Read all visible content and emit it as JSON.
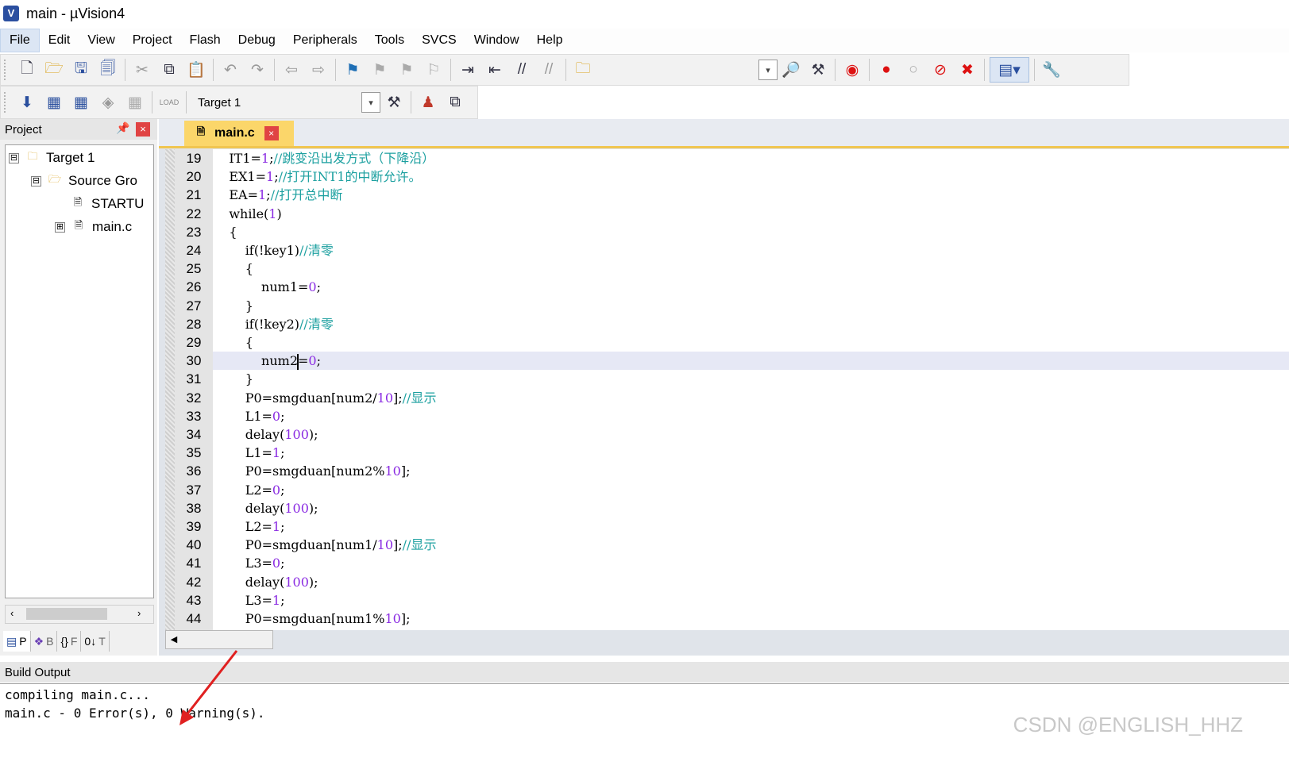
{
  "window": {
    "title": "main  - µVision4",
    "icon": "uvision-icon"
  },
  "menu": [
    "File",
    "Edit",
    "View",
    "Project",
    "Flash",
    "Debug",
    "Peripherals",
    "Tools",
    "SVCS",
    "Window",
    "Help"
  ],
  "toolbar2": {
    "target": "Target 1",
    "load_label": "LOAD"
  },
  "project_panel": {
    "title": "Project",
    "tree": [
      {
        "label": "Target 1",
        "level": 0,
        "expander": "⊟"
      },
      {
        "label": "Source Gro",
        "level": 1,
        "expander": "⊟"
      },
      {
        "label": "STARTU",
        "level": 2,
        "expander": ""
      },
      {
        "label": "main.c",
        "level": 2,
        "expander": "⊞"
      }
    ],
    "tabs": [
      "P",
      "B",
      "F",
      "T"
    ]
  },
  "editor": {
    "tab_label": "main.c",
    "highlighted_line": 30,
    "lines": [
      {
        "n": "19",
        "code": "    IT1=1;//跳变沿出发方式（下降沿）"
      },
      {
        "n": "20",
        "code": "    EX1=1;//打开INT1的中断允许。"
      },
      {
        "n": "21",
        "code": "    EA=1;//打开总中断"
      },
      {
        "n": "22",
        "code": "    while(1)"
      },
      {
        "n": "23",
        "code": "    {"
      },
      {
        "n": "24",
        "code": "        if(!key1)//清零"
      },
      {
        "n": "25",
        "code": "        {"
      },
      {
        "n": "26",
        "code": "            num1=0;"
      },
      {
        "n": "27",
        "code": "        }"
      },
      {
        "n": "28",
        "code": "        if(!key2)//清零"
      },
      {
        "n": "29",
        "code": "        {"
      },
      {
        "n": "30",
        "code": "            num2=0;"
      },
      {
        "n": "31",
        "code": "        }"
      },
      {
        "n": "32",
        "code": "        P0=smgduan[num2/10];//显示"
      },
      {
        "n": "33",
        "code": "        L1=0;"
      },
      {
        "n": "34",
        "code": "        delay(100);"
      },
      {
        "n": "35",
        "code": "        L1=1;"
      },
      {
        "n": "36",
        "code": "        P0=smgduan[num2%10];"
      },
      {
        "n": "37",
        "code": "        L2=0;"
      },
      {
        "n": "38",
        "code": "        delay(100);"
      },
      {
        "n": "39",
        "code": "        L2=1;"
      },
      {
        "n": "40",
        "code": "        P0=smgduan[num1/10];//显示"
      },
      {
        "n": "41",
        "code": "        L3=0;"
      },
      {
        "n": "42",
        "code": "        delay(100);"
      },
      {
        "n": "43",
        "code": "        L3=1;"
      },
      {
        "n": "44",
        "code": "        P0=smgduan[num1%10];"
      }
    ]
  },
  "build_output": {
    "title": "Build Output",
    "lines": [
      "compiling main.c...",
      "main.c - 0 Error(s), 0 Warning(s)."
    ]
  },
  "watermark": "CSDN @ENGLISH_HHZ",
  "colors": {
    "accent_tab": "#fbd66a",
    "comment": "#1ca0a0",
    "number": "#8a2be2",
    "close": "#e04343",
    "current_line": "#e6e8f5",
    "annotation_arrow": "#e02020"
  }
}
